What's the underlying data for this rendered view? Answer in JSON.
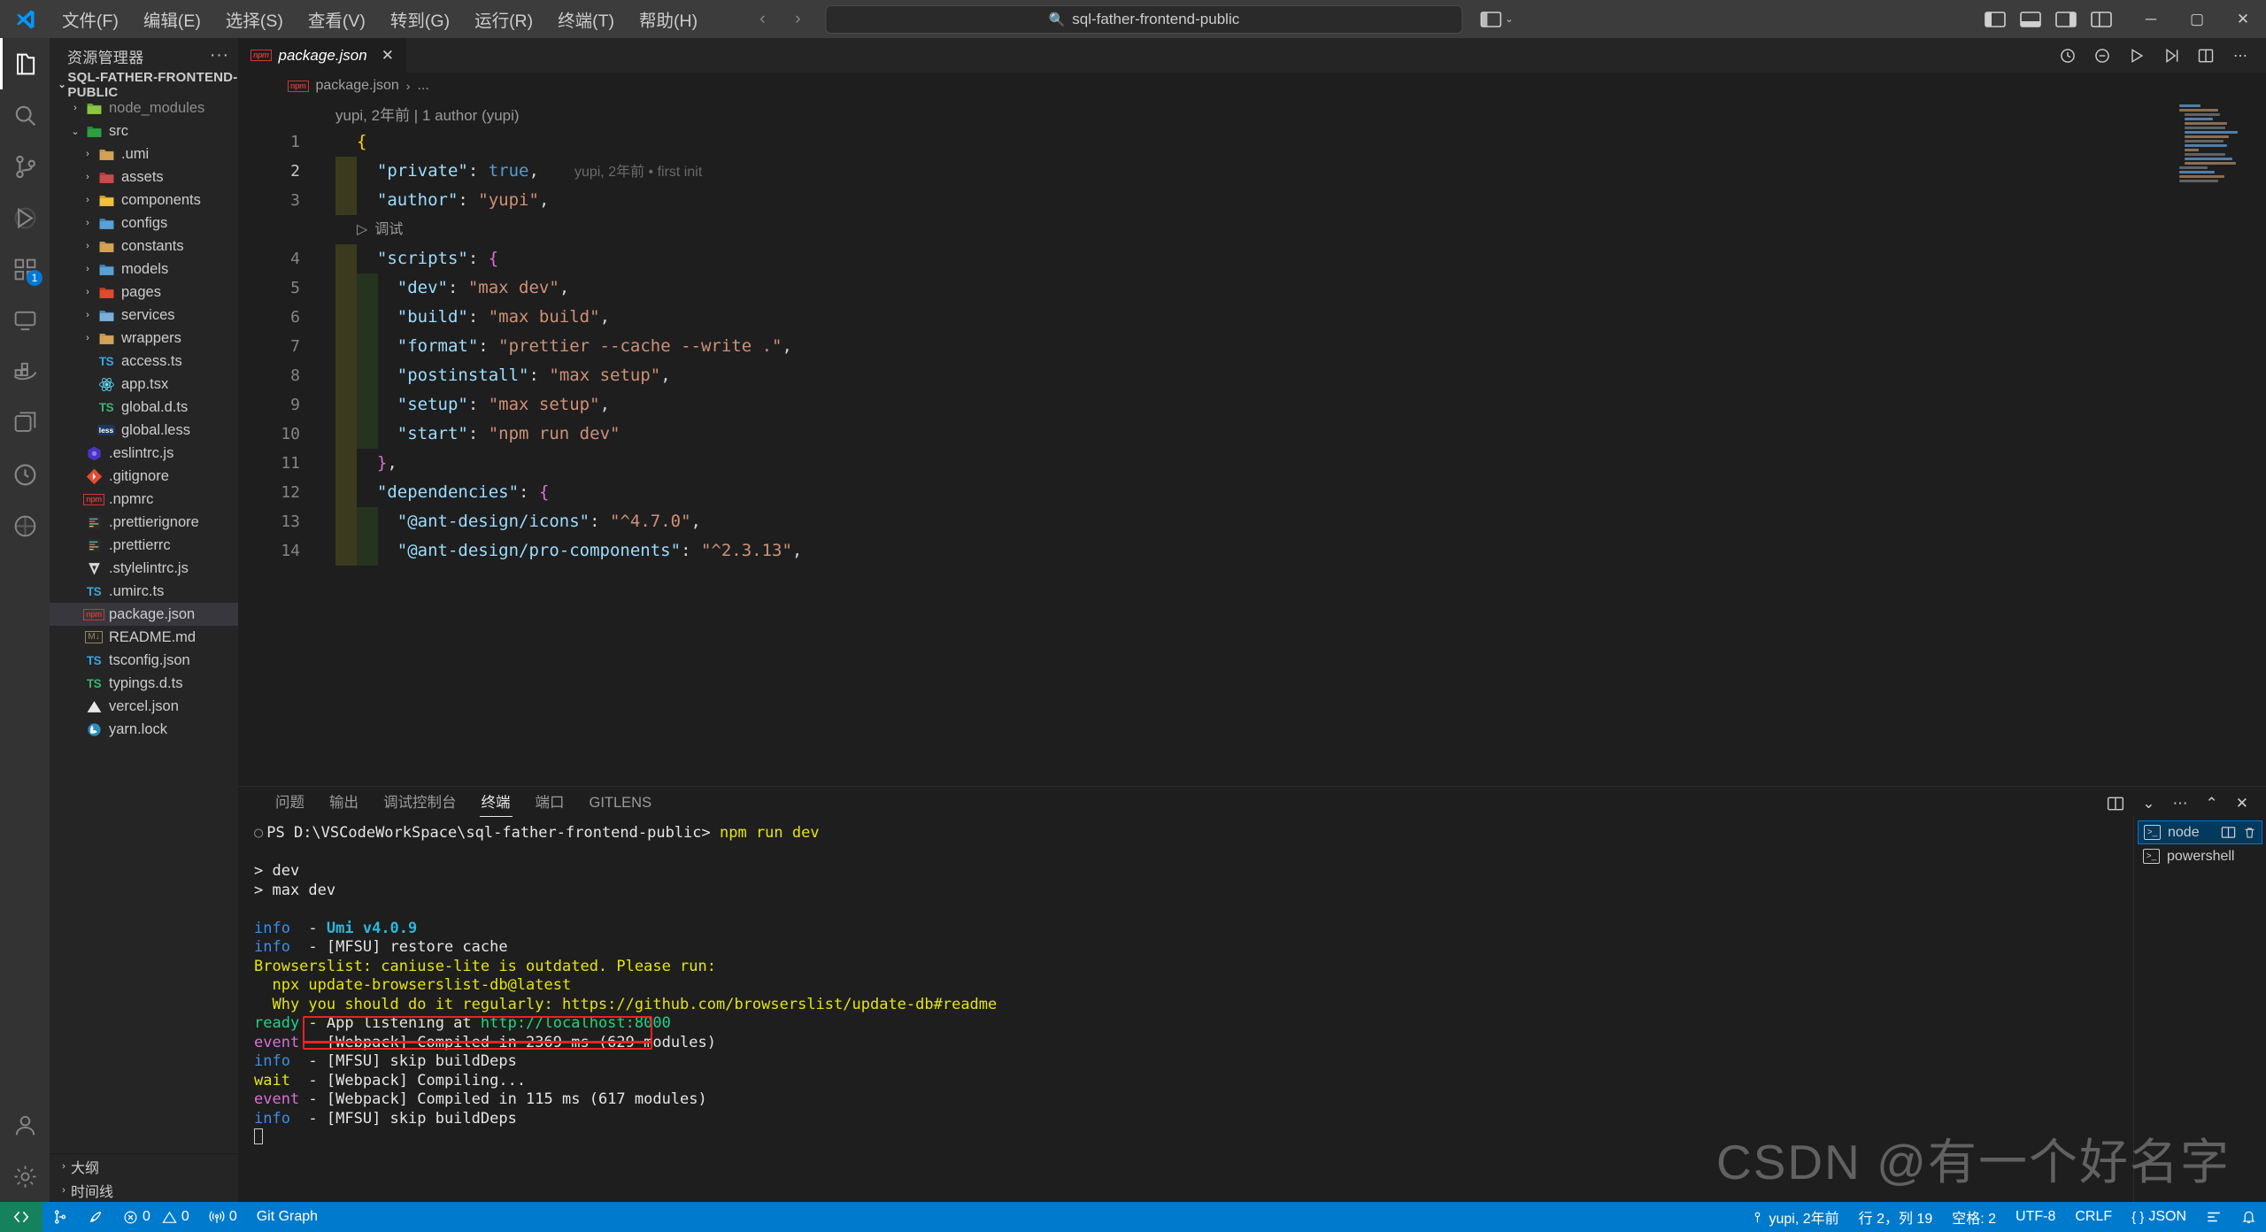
{
  "window": {
    "menu": [
      "文件(F)",
      "编辑(E)",
      "选择(S)",
      "查看(V)",
      "转到(G)",
      "运行(R)",
      "终端(T)",
      "帮助(H)"
    ],
    "search_value": "sql-father-frontend-public",
    "search_icon": "search-icon",
    "minimize": "─",
    "maximize": "▢",
    "close": "✕"
  },
  "activitybar": {
    "items": [
      {
        "name": "explorer",
        "badge": ""
      },
      {
        "name": "search",
        "badge": ""
      },
      {
        "name": "source-control",
        "badge": ""
      },
      {
        "name": "run-and-debug",
        "badge": ""
      },
      {
        "name": "extensions",
        "badge": "1"
      },
      {
        "name": "remote-explorer",
        "badge": ""
      },
      {
        "name": "docker",
        "badge": ""
      },
      {
        "name": "project-manager",
        "badge": ""
      },
      {
        "name": "todo-tree",
        "badge": ""
      },
      {
        "name": "gitlens",
        "badge": ""
      }
    ],
    "bottom": [
      {
        "name": "accounts"
      },
      {
        "name": "settings"
      }
    ]
  },
  "sidebar": {
    "title": "资源管理器",
    "more": "···",
    "root": "SQL-FATHER-FRONTEND-PUBLIC",
    "sections": [
      "大纲",
      "时间线"
    ],
    "tree": [
      {
        "label": "node_modules",
        "icon": "folder-node",
        "indent": 1,
        "arrow": "›",
        "dim": true
      },
      {
        "label": "src",
        "icon": "folder-src",
        "indent": 1,
        "arrow": "⌄",
        "dim": false
      },
      {
        "label": ".umi",
        "icon": "folder-plain",
        "indent": 2,
        "arrow": "›",
        "dim": false
      },
      {
        "label": "assets",
        "icon": "folder-assets",
        "indent": 2,
        "arrow": "›",
        "dim": false
      },
      {
        "label": "components",
        "icon": "folder-components",
        "indent": 2,
        "arrow": "›",
        "dim": false
      },
      {
        "label": "configs",
        "icon": "folder-config",
        "indent": 2,
        "arrow": "›",
        "dim": false
      },
      {
        "label": "constants",
        "icon": "folder-plain",
        "indent": 2,
        "arrow": "›",
        "dim": false
      },
      {
        "label": "models",
        "icon": "folder-models",
        "indent": 2,
        "arrow": "›",
        "dim": false
      },
      {
        "label": "pages",
        "icon": "folder-pages",
        "indent": 2,
        "arrow": "›",
        "dim": false
      },
      {
        "label": "services",
        "icon": "folder-services",
        "indent": 2,
        "arrow": "›",
        "dim": false
      },
      {
        "label": "wrappers",
        "icon": "folder-plain",
        "indent": 2,
        "arrow": "›",
        "dim": false
      },
      {
        "label": "access.ts",
        "icon": "ts-file",
        "indent": 2,
        "arrow": "",
        "dim": false
      },
      {
        "label": "app.tsx",
        "icon": "react-file",
        "indent": 2,
        "arrow": "",
        "dim": false
      },
      {
        "label": "global.d.ts",
        "icon": "ts-def-file",
        "indent": 2,
        "arrow": "",
        "dim": false
      },
      {
        "label": "global.less",
        "icon": "less-file",
        "indent": 2,
        "arrow": "",
        "dim": false
      },
      {
        "label": ".eslintrc.js",
        "icon": "eslint-file",
        "indent": 1,
        "arrow": "",
        "dim": false
      },
      {
        "label": ".gitignore",
        "icon": "git-file",
        "indent": 1,
        "arrow": "",
        "dim": false
      },
      {
        "label": ".npmrc",
        "icon": "npm-file",
        "indent": 1,
        "arrow": "",
        "dim": false
      },
      {
        "label": ".prettierignore",
        "icon": "prettier-file",
        "indent": 1,
        "arrow": "",
        "dim": false
      },
      {
        "label": ".prettierrc",
        "icon": "prettier-file",
        "indent": 1,
        "arrow": "",
        "dim": false
      },
      {
        "label": ".stylelintrc.js",
        "icon": "stylelint-file",
        "indent": 1,
        "arrow": "",
        "dim": false
      },
      {
        "label": ".umirc.ts",
        "icon": "ts-file",
        "indent": 1,
        "arrow": "",
        "dim": false
      },
      {
        "label": "package.json",
        "icon": "npm-file",
        "indent": 1,
        "arrow": "",
        "dim": false,
        "selected": true
      },
      {
        "label": "README.md",
        "icon": "md-file",
        "indent": 1,
        "arrow": "",
        "dim": false
      },
      {
        "label": "tsconfig.json",
        "icon": "tsconfig-file",
        "indent": 1,
        "arrow": "",
        "dim": false
      },
      {
        "label": "typings.d.ts",
        "icon": "ts-def-file",
        "indent": 1,
        "arrow": "",
        "dim": false
      },
      {
        "label": "vercel.json",
        "icon": "vercel-file",
        "indent": 1,
        "arrow": "",
        "dim": false
      },
      {
        "label": "yarn.lock",
        "icon": "yarn-file",
        "indent": 1,
        "arrow": "",
        "dim": false
      }
    ]
  },
  "editor": {
    "tab": {
      "label": "package.json",
      "icon": "npm-file",
      "close": "✕"
    },
    "breadcrumb": {
      "file": "package.json",
      "sep": "›",
      "rest": "..."
    },
    "codelens": "yupi, 2年前 | 1 author (yupi)",
    "inline_blame": "yupi, 2年前 • first init",
    "debug_lens": "调试",
    "lines": [
      {
        "no": "1",
        "tokens": [
          {
            "t": "{",
            "c": "brace"
          }
        ]
      },
      {
        "no": "2",
        "hl": true,
        "tokens": [
          {
            "t": "  ",
            "c": "punc"
          },
          {
            "t": "\"private\"",
            "c": "key"
          },
          {
            "t": ": ",
            "c": "punc"
          },
          {
            "t": "true",
            "c": "bool"
          },
          {
            "t": ",",
            "c": "punc"
          }
        ]
      },
      {
        "no": "3",
        "hl": true,
        "tokens": [
          {
            "t": "  ",
            "c": "punc"
          },
          {
            "t": "\"author\"",
            "c": "key"
          },
          {
            "t": ": ",
            "c": "punc"
          },
          {
            "t": "\"yupi\"",
            "c": "str"
          },
          {
            "t": ",",
            "c": "punc"
          }
        ]
      },
      {
        "no": "4",
        "hl": true,
        "tokens": [
          {
            "t": "  ",
            "c": "punc"
          },
          {
            "t": "\"scripts\"",
            "c": "key"
          },
          {
            "t": ": ",
            "c": "punc"
          },
          {
            "t": "{",
            "c": "brace2"
          }
        ]
      },
      {
        "no": "5",
        "hl": true,
        "hl2": true,
        "tokens": [
          {
            "t": "    ",
            "c": "punc"
          },
          {
            "t": "\"dev\"",
            "c": "key"
          },
          {
            "t": ": ",
            "c": "punc"
          },
          {
            "t": "\"max dev\"",
            "c": "str"
          },
          {
            "t": ",",
            "c": "punc"
          }
        ]
      },
      {
        "no": "6",
        "hl": true,
        "hl2": true,
        "tokens": [
          {
            "t": "    ",
            "c": "punc"
          },
          {
            "t": "\"build\"",
            "c": "key"
          },
          {
            "t": ": ",
            "c": "punc"
          },
          {
            "t": "\"max build\"",
            "c": "str"
          },
          {
            "t": ",",
            "c": "punc"
          }
        ]
      },
      {
        "no": "7",
        "hl": true,
        "hl2": true,
        "tokens": [
          {
            "t": "    ",
            "c": "punc"
          },
          {
            "t": "\"format\"",
            "c": "key"
          },
          {
            "t": ": ",
            "c": "punc"
          },
          {
            "t": "\"prettier --cache --write .\"",
            "c": "str"
          },
          {
            "t": ",",
            "c": "punc"
          }
        ]
      },
      {
        "no": "8",
        "hl": true,
        "hl2": true,
        "tokens": [
          {
            "t": "    ",
            "c": "punc"
          },
          {
            "t": "\"postinstall\"",
            "c": "key"
          },
          {
            "t": ": ",
            "c": "punc"
          },
          {
            "t": "\"max setup\"",
            "c": "str"
          },
          {
            "t": ",",
            "c": "punc"
          }
        ]
      },
      {
        "no": "9",
        "hl": true,
        "hl2": true,
        "tokens": [
          {
            "t": "    ",
            "c": "punc"
          },
          {
            "t": "\"setup\"",
            "c": "key"
          },
          {
            "t": ": ",
            "c": "punc"
          },
          {
            "t": "\"max setup\"",
            "c": "str"
          },
          {
            "t": ",",
            "c": "punc"
          }
        ]
      },
      {
        "no": "10",
        "hl": true,
        "hl2": true,
        "tokens": [
          {
            "t": "    ",
            "c": "punc"
          },
          {
            "t": "\"start\"",
            "c": "key"
          },
          {
            "t": ": ",
            "c": "punc"
          },
          {
            "t": "\"npm run dev\"",
            "c": "str"
          }
        ]
      },
      {
        "no": "11",
        "hl": true,
        "tokens": [
          {
            "t": "  ",
            "c": "punc"
          },
          {
            "t": "}",
            "c": "brace2"
          },
          {
            "t": ",",
            "c": "punc"
          }
        ]
      },
      {
        "no": "12",
        "hl": true,
        "tokens": [
          {
            "t": "  ",
            "c": "punc"
          },
          {
            "t": "\"dependencies\"",
            "c": "key"
          },
          {
            "t": ": ",
            "c": "punc"
          },
          {
            "t": "{",
            "c": "brace2"
          }
        ]
      },
      {
        "no": "13",
        "hl": true,
        "hl2": true,
        "tokens": [
          {
            "t": "    ",
            "c": "punc"
          },
          {
            "t": "\"@ant-design/icons\"",
            "c": "key"
          },
          {
            "t": ": ",
            "c": "punc"
          },
          {
            "t": "\"^4.7.0\"",
            "c": "str"
          },
          {
            "t": ",",
            "c": "punc"
          }
        ]
      },
      {
        "no": "14",
        "hl": true,
        "hl2": true,
        "tokens": [
          {
            "t": "    ",
            "c": "punc"
          },
          {
            "t": "\"@ant-design/pro-components\"",
            "c": "key"
          },
          {
            "t": ": ",
            "c": "punc"
          },
          {
            "t": "\"^2.3.13\"",
            "c": "str"
          },
          {
            "t": ",",
            "c": "punc"
          }
        ]
      }
    ]
  },
  "panel": {
    "tabs": [
      "问题",
      "输出",
      "调试控制台",
      "终端",
      "端口",
      "GITLENS"
    ],
    "active_tab": "终端",
    "actions": [
      "split-panel-icon",
      "chevron-down-icon",
      "more-icon",
      "maximize-panel-icon",
      "close-panel-icon"
    ],
    "terminal_lines": [
      {
        "parts": [
          {
            "t": "PS D:\\VSCodeWorkSpace\\sql-father-frontend-public> ",
            "c": "t-white"
          },
          {
            "t": "npm run dev",
            "c": "t-yellow"
          }
        ],
        "prompt": true
      },
      {
        "parts": [
          {
            "t": "",
            "c": "t-white"
          }
        ]
      },
      {
        "parts": [
          {
            "t": "> dev",
            "c": "t-white"
          }
        ]
      },
      {
        "parts": [
          {
            "t": "> max dev",
            "c": "t-white"
          }
        ]
      },
      {
        "parts": [
          {
            "t": "",
            "c": "t-white"
          }
        ]
      },
      {
        "parts": [
          {
            "t": "info  ",
            "c": "t-info"
          },
          {
            "t": "- ",
            "c": "t-white"
          },
          {
            "t": "Umi v4.0.9",
            "c": "t-cyan t-bold"
          }
        ]
      },
      {
        "parts": [
          {
            "t": "info  ",
            "c": "t-info"
          },
          {
            "t": "- [MFSU] restore cache",
            "c": "t-white"
          }
        ]
      },
      {
        "parts": [
          {
            "t": "Browserslist: caniuse-lite is outdated. Please run:",
            "c": "t-yellow"
          }
        ]
      },
      {
        "parts": [
          {
            "t": "  npx update-browserslist-db@latest",
            "c": "t-yellow"
          }
        ]
      },
      {
        "parts": [
          {
            "t": "  Why you should do it regularly: https://github.com/browserslist/update-db#readme",
            "c": "t-yellow"
          }
        ]
      },
      {
        "parts": [
          {
            "t": "ready ",
            "c": "t-ready"
          },
          {
            "t": "- App listening at ",
            "c": "t-white"
          },
          {
            "t": "http://localhost:8000",
            "c": "t-green"
          }
        ]
      },
      {
        "parts": [
          {
            "t": "event ",
            "c": "t-event"
          },
          {
            "t": "- [Webpack] Compiled in 2369 ms (629 modules)",
            "c": "t-white"
          }
        ]
      },
      {
        "parts": [
          {
            "t": "info  ",
            "c": "t-info"
          },
          {
            "t": "- [MFSU] skip buildDeps",
            "c": "t-white"
          }
        ]
      },
      {
        "parts": [
          {
            "t": "wait  ",
            "c": "t-wait"
          },
          {
            "t": "- [Webpack] Compiling...",
            "c": "t-white"
          }
        ]
      },
      {
        "parts": [
          {
            "t": "event ",
            "c": "t-event"
          },
          {
            "t": "- [Webpack] Compiled in 115 ms (617 modules)",
            "c": "t-white"
          }
        ]
      },
      {
        "parts": [
          {
            "t": "info  ",
            "c": "t-info"
          },
          {
            "t": "- [MFSU] skip buildDeps",
            "c": "t-white"
          }
        ]
      }
    ],
    "terminal_list": [
      {
        "label": "node",
        "active": true,
        "icon": "terminal-icon"
      },
      {
        "label": "powershell",
        "active": false,
        "icon": "terminal-icon"
      }
    ],
    "highlight_color": "#f02020"
  },
  "statusbar": {
    "remote_icon": "remote-icon",
    "left": [
      {
        "name": "source-control-branch",
        "icon": "branch-icon",
        "label": ""
      },
      {
        "name": "sync-changes",
        "icon": "rocket-icon",
        "label": ""
      },
      {
        "name": "problems-errors",
        "icon": "error-icon",
        "label": "0"
      },
      {
        "name": "problems-warnings",
        "icon": "warning-icon",
        "label": "0"
      },
      {
        "name": "ports-forwarded",
        "icon": "radio-tower-icon",
        "label": "0"
      },
      {
        "name": "git-graph",
        "icon": "",
        "label": "Git Graph"
      }
    ],
    "right": [
      {
        "name": "git-blame",
        "icon": "person-icon",
        "label": "yupi, 2年前"
      },
      {
        "name": "editor-position",
        "icon": "",
        "label": "行 2，列 19"
      },
      {
        "name": "indentation",
        "icon": "",
        "label": "空格: 2"
      },
      {
        "name": "encoding",
        "icon": "",
        "label": "UTF-8"
      },
      {
        "name": "eol",
        "icon": "",
        "label": "CRLF"
      },
      {
        "name": "language-mode",
        "icon": "braces-icon",
        "label": "JSON"
      },
      {
        "name": "prettier",
        "icon": "prettier-icon",
        "label": ""
      },
      {
        "name": "notifications",
        "icon": "bell-icon",
        "label": ""
      }
    ]
  },
  "watermark": "CSDN @有一个好名字"
}
